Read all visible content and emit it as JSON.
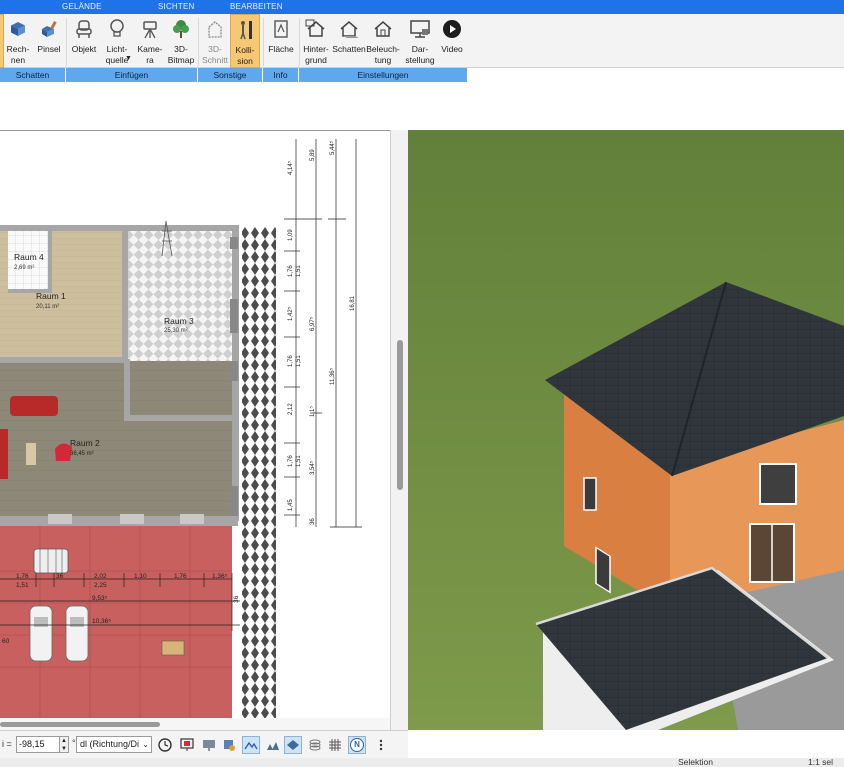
{
  "ribbon": {
    "tabs": [
      "GELÄNDE",
      "SICHTEN",
      "BEARBEITEN"
    ],
    "buttons": {
      "rechnen": "Rech-\nnen",
      "pinsel": "Pinsel",
      "objekt": "Objekt",
      "lichtquelle": "Licht-\nquelle",
      "kamera": "Kame-\nra",
      "bitmap3d": "3D-\nBitmap",
      "schnitt3d": "3D-\nSchnitt",
      "kollision": "Kolli-\nsion",
      "flaeche": "Fläche",
      "hintergrund": "Hinter-\ngrund",
      "schatten": "Schatten",
      "beleuchtung": "Beleuch-\ntung",
      "darstellung": "Dar-\nstellung",
      "video": "Video"
    },
    "groups": {
      "schatten": "Schatten",
      "einfuegen": "Einfügen",
      "sonstige": "Sonstige",
      "info": "Info",
      "einstellungen": "Einstellungen"
    }
  },
  "plan": {
    "rooms": [
      {
        "name": "Raum 4",
        "area": "2,69 m²"
      },
      {
        "name": "Raum 1",
        "area": "20,11 m²"
      },
      {
        "name": "Raum 3",
        "area": "25,30 m²"
      },
      {
        "name": "Raum 2",
        "area": "36,45 m²"
      }
    ],
    "dimensions": {
      "right_chain_a": [
        "4,14⁵",
        "1,09",
        "1,76",
        "1,42⁵",
        "1,76",
        "2,12",
        "1,76",
        "1,45",
        "36"
      ],
      "right_chain_b": [
        "1,51",
        "1,51",
        "1,51"
      ],
      "right_chain_c": [
        "5,89",
        "6,97⁵",
        "3,54⁵"
      ],
      "right_chain_d": [
        "5,44⁵",
        "11,36⁵"
      ],
      "right_total": "16,81",
      "bottom_row_1": [
        "1,76",
        "36",
        "2,02",
        "1,10",
        "1,76",
        "1,36⁵"
      ],
      "bottom_row_2": [
        "1,51",
        "2,25"
      ],
      "bottom_row_3": [
        "9,53⁵"
      ],
      "bottom_row_4": [
        "10,36⁵"
      ],
      "left_edge": "60",
      "right_mark": "36"
    }
  },
  "toolbar": {
    "coord_label": "i =",
    "coord_value": "-98,15",
    "coord_unit": "°",
    "mode": "dl (Richtung/Di",
    "icons": [
      "clock-icon",
      "presentation-icon",
      "monitor-icon",
      "paint-icon",
      "terrain-icon",
      "trees-icon",
      "layer-icon",
      "stack-icon",
      "grid-icon",
      "north-icon",
      "more-icon"
    ],
    "north_label": "N"
  },
  "status": {
    "mode": "Selektion",
    "selection": "1:1 sel"
  },
  "colors": {
    "ribbon_tab": "#1e73e8",
    "group_band": "#5fa8ee",
    "active_button": "#f7c873",
    "grass": "#6f8a3e",
    "roof": "#2c3339",
    "facade": "#e1894d",
    "garage_floor": "#c96060"
  }
}
